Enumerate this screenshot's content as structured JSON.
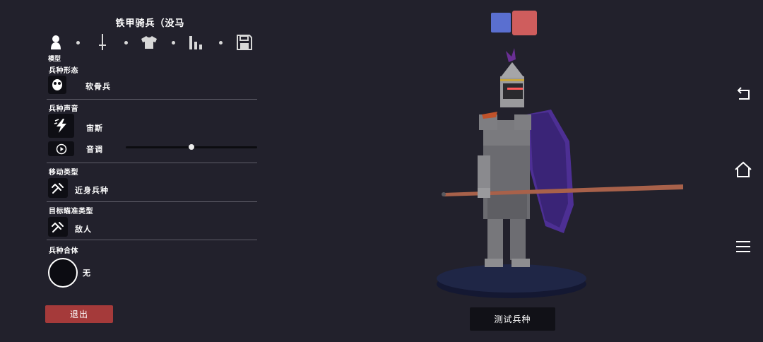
{
  "unit_title": "铁甲骑兵（没马",
  "tabs": [
    {
      "name": "model",
      "icon": "person-icon",
      "label": "模型"
    },
    {
      "name": "weapon",
      "icon": "sword-icon"
    },
    {
      "name": "clothing",
      "icon": "shirt-icon"
    },
    {
      "name": "stats",
      "icon": "bar-chart-icon"
    },
    {
      "name": "save",
      "icon": "floppy-disk-icon"
    }
  ],
  "sections": {
    "unit_form": {
      "label": "兵种形态",
      "value": "软骨兵",
      "icon": "mask-icon"
    },
    "unit_voice": {
      "label": "兵种声音",
      "value": "宙斯",
      "icon": "lightning-icon",
      "pitch_label": "音调",
      "pitch_level": 0.5
    },
    "movement_type": {
      "label": "移动类型",
      "value": "近身兵种",
      "icon": "melee-icon"
    },
    "target_type": {
      "label": "目标瞄准类型",
      "value": "敌人",
      "icon": "melee-icon"
    },
    "unit_fusion": {
      "label": "兵种合体",
      "value": "无"
    }
  },
  "exit_label": "退出",
  "test_label": "测试兵种",
  "team_colors": {
    "blue": "#5a6fd0",
    "red": "#cf5d5d"
  },
  "nav": [
    "back-icon",
    "home-icon",
    "menu-icon"
  ]
}
